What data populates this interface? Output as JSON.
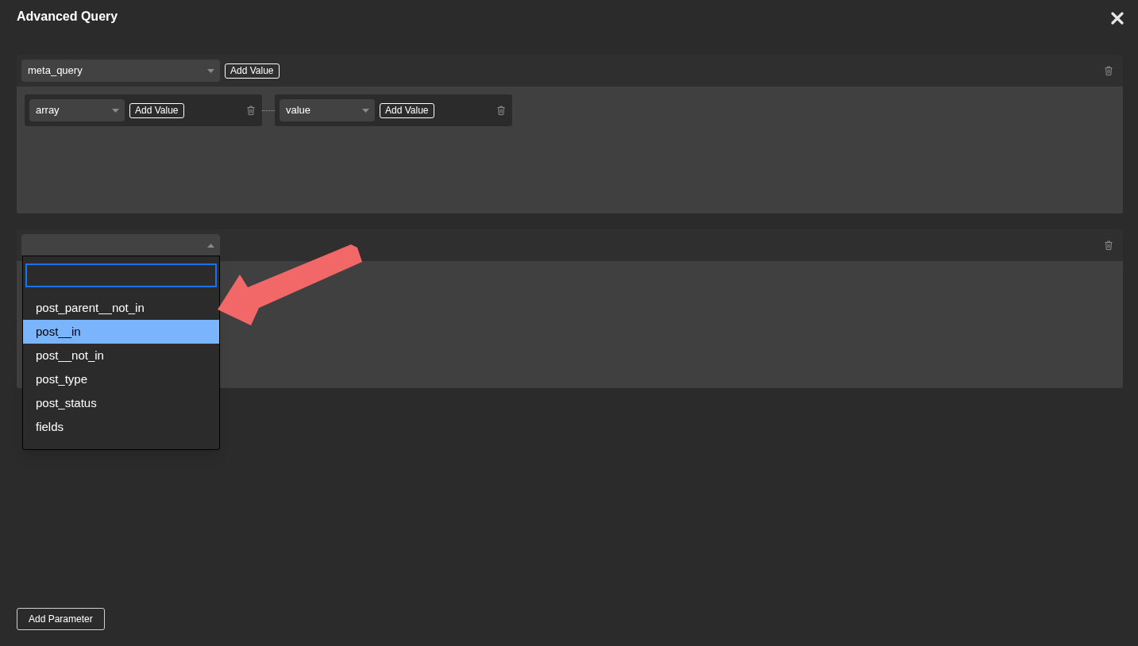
{
  "title": "Advanced Query",
  "parameters": [
    {
      "select": {
        "value": "meta_query",
        "open": false
      },
      "add_button": "Add Value",
      "values": [
        {
          "select": "array",
          "add_button": "Add Value"
        },
        {
          "select": "value",
          "add_button": "Add Value"
        }
      ]
    },
    {
      "select": {
        "open": true
      },
      "dropdown": {
        "options": [
          {
            "label": "post_parent__not_in",
            "selected": false
          },
          {
            "label": "post__in",
            "selected": true
          },
          {
            "label": "post__not_in",
            "selected": false
          },
          {
            "label": "post_type",
            "selected": false
          },
          {
            "label": "post_status",
            "selected": false
          },
          {
            "label": "fields",
            "selected": false
          }
        ]
      }
    }
  ],
  "add_parameter": "Add Parameter"
}
